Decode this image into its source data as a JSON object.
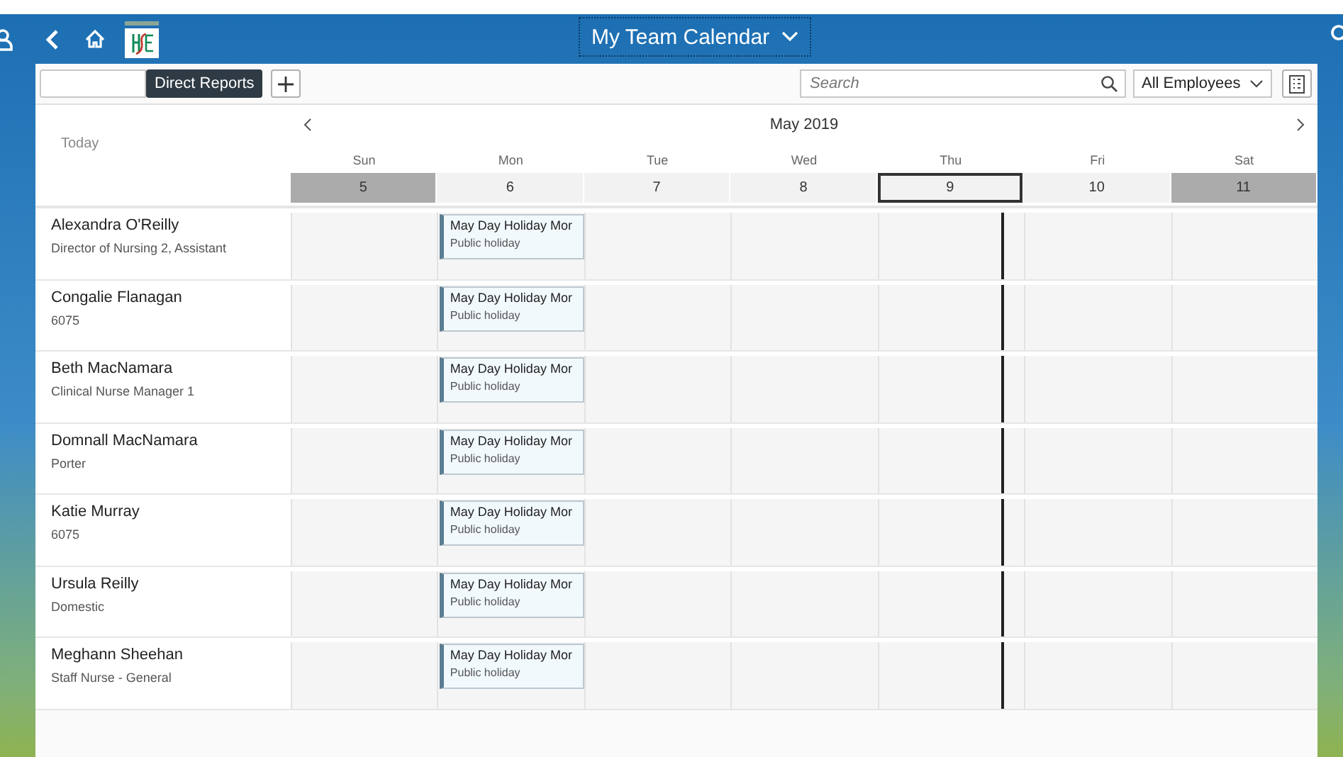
{
  "header": {
    "title": "My Team Calendar"
  },
  "toolbar": {
    "tooltip": "Direct Reports",
    "search": {
      "placeholder": "Search"
    },
    "filter": {
      "value": "All Employees"
    }
  },
  "calendar": {
    "today_button": "Today",
    "month": "May 2019",
    "days": [
      {
        "weekday": "Sun",
        "date": "5",
        "weekend": true,
        "today": false
      },
      {
        "weekday": "Mon",
        "date": "6",
        "weekend": false,
        "today": false
      },
      {
        "weekday": "Tue",
        "date": "7",
        "weekend": false,
        "today": false
      },
      {
        "weekday": "Wed",
        "date": "8",
        "weekend": false,
        "today": false
      },
      {
        "weekday": "Thu",
        "date": "9",
        "weekend": false,
        "today": true
      },
      {
        "weekday": "Fri",
        "date": "10",
        "weekend": false,
        "today": false
      },
      {
        "weekday": "Sat",
        "date": "11",
        "weekend": true,
        "today": false
      }
    ],
    "employees": [
      {
        "name": "Alexandra O'Reilly",
        "title": "Director of Nursing 2, Assistant",
        "cells": [
          {
            "kind": "empty"
          },
          {
            "kind": "appointment",
            "title": "May Day Holiday Mor",
            "subtitle": "Public holiday"
          },
          {
            "kind": "empty"
          },
          {
            "kind": "empty"
          },
          {
            "kind": "empty"
          },
          {
            "kind": "empty"
          },
          {
            "kind": "empty"
          }
        ]
      },
      {
        "name": "Congalie Flanagan",
        "title": "6075",
        "cells": [
          {
            "kind": "empty"
          },
          {
            "kind": "appointment",
            "title": "May Day Holiday Mor",
            "subtitle": "Public holiday"
          },
          {
            "kind": "empty"
          },
          {
            "kind": "empty"
          },
          {
            "kind": "empty"
          },
          {
            "kind": "empty"
          },
          {
            "kind": "empty"
          }
        ]
      },
      {
        "name": "Beth MacNamara",
        "title": "Clinical Nurse Manager 1",
        "cells": [
          {
            "kind": "empty"
          },
          {
            "kind": "appointment",
            "title": "May Day Holiday Mor",
            "subtitle": "Public holiday"
          },
          {
            "kind": "empty"
          },
          {
            "kind": "empty"
          },
          {
            "kind": "empty"
          },
          {
            "kind": "empty"
          },
          {
            "kind": "empty"
          }
        ]
      },
      {
        "name": "Domnall MacNamara",
        "title": "Porter",
        "cells": [
          {
            "kind": "empty"
          },
          {
            "kind": "appointment",
            "title": "May Day Holiday Mor",
            "subtitle": "Public holiday"
          },
          {
            "kind": "empty"
          },
          {
            "kind": "empty"
          },
          {
            "kind": "empty"
          },
          {
            "kind": "empty"
          },
          {
            "kind": "empty"
          }
        ]
      },
      {
        "name": "Katie Murray",
        "title": "6075",
        "cells": [
          {
            "kind": "empty"
          },
          {
            "kind": "appointment",
            "title": "May Day Holiday Mor",
            "subtitle": "Public holiday"
          },
          {
            "kind": "empty"
          },
          {
            "kind": "empty"
          },
          {
            "kind": "empty"
          },
          {
            "kind": "empty"
          },
          {
            "kind": "empty"
          }
        ]
      },
      {
        "name": "Ursula Reilly",
        "title": "Domestic",
        "cells": [
          {
            "kind": "empty"
          },
          {
            "kind": "appointment",
            "title": "May Day Holiday Mor",
            "subtitle": "Public holiday"
          },
          {
            "kind": "empty"
          },
          {
            "kind": "empty"
          },
          {
            "kind": "empty"
          },
          {
            "kind": "empty"
          },
          {
            "kind": "empty"
          }
        ]
      },
      {
        "name": "Meghann Sheehan",
        "title": "Staff Nurse - General",
        "cells": [
          {
            "kind": "empty"
          },
          {
            "kind": "appointment",
            "title": "May Day Holiday Mor",
            "subtitle": "Public holiday"
          },
          {
            "kind": "empty"
          },
          {
            "kind": "empty"
          },
          {
            "kind": "empty"
          },
          {
            "kind": "empty"
          },
          {
            "kind": "empty"
          }
        ]
      }
    ]
  }
}
